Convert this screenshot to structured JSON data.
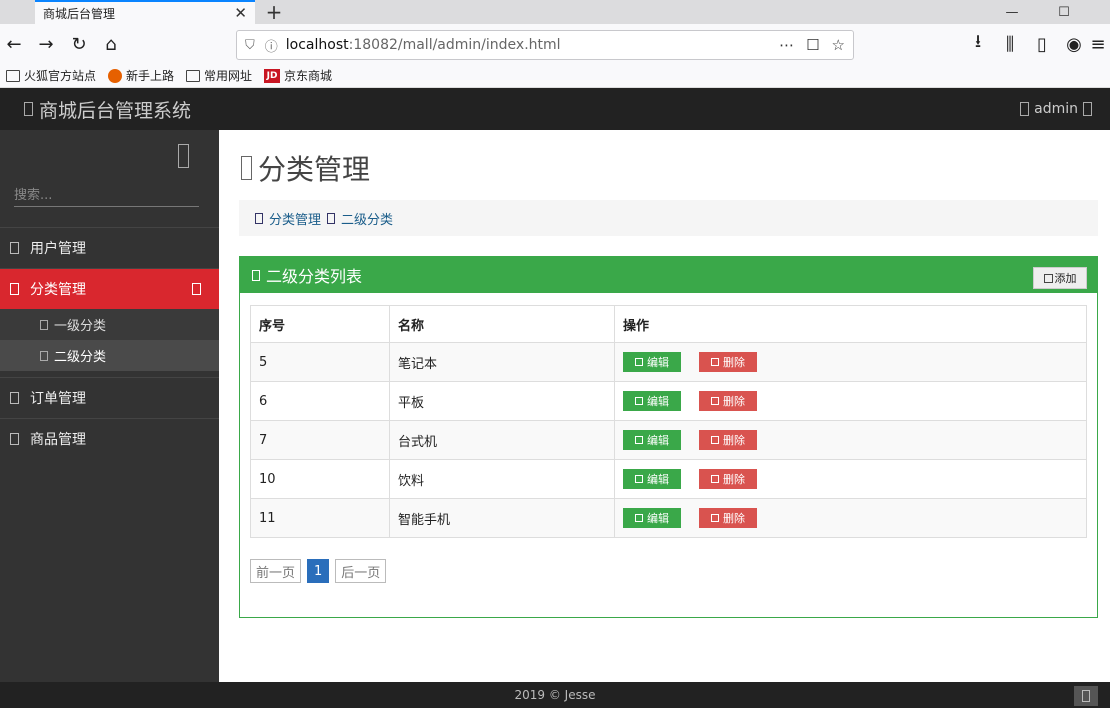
{
  "browser": {
    "tab_title": "商城后台管理",
    "url_host": "localhost",
    "url_rest": ":18082/mall/admin/index.html",
    "bookmarks": [
      "火狐官方站点",
      "新手上路",
      "常用网址",
      "京东商城"
    ]
  },
  "header": {
    "title": "商城后台管理系统",
    "user": "admin"
  },
  "sidebar": {
    "search_placeholder": "搜索...",
    "items": [
      {
        "label": "用户管理"
      },
      {
        "label": "分类管理",
        "children": [
          {
            "label": "一级分类"
          },
          {
            "label": "二级分类"
          }
        ]
      },
      {
        "label": "订单管理"
      },
      {
        "label": "商品管理"
      }
    ]
  },
  "main": {
    "page_title": "分类管理",
    "breadcrumb": [
      "分类管理",
      "二级分类"
    ],
    "panel_title": "二级分类列表",
    "add_label": "添加",
    "columns": [
      "序号",
      "名称",
      "操作"
    ],
    "rows": [
      {
        "id": "5",
        "name": "笔记本"
      },
      {
        "id": "6",
        "name": "平板"
      },
      {
        "id": "7",
        "name": "台式机"
      },
      {
        "id": "10",
        "name": "饮料"
      },
      {
        "id": "11",
        "name": "智能手机"
      }
    ],
    "edit_label": "编辑",
    "delete_label": "删除",
    "pager": {
      "prev": "前一页",
      "current": "1",
      "next": "后一页"
    }
  },
  "footer": {
    "text": "2019 © Jesse"
  },
  "colors": {
    "accent_red": "#d9272e",
    "panel_green": "#3aa849",
    "delete_red": "#d9534f",
    "page_blue": "#2a6ebb"
  }
}
